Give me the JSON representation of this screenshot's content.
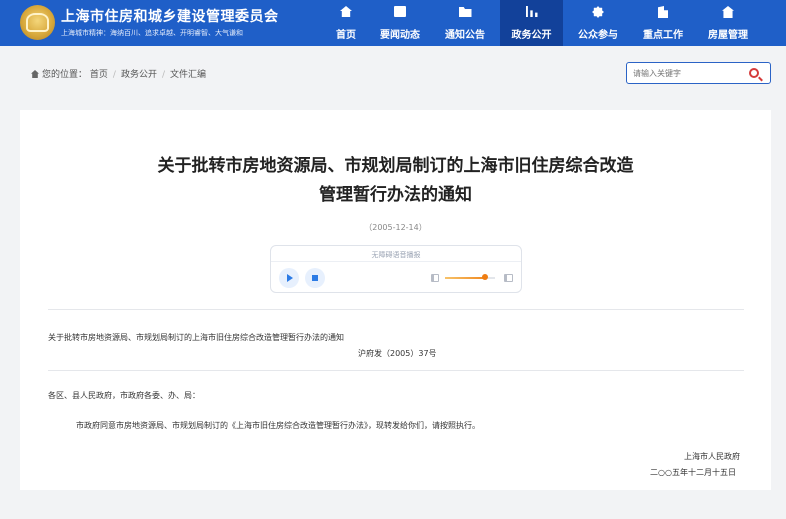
{
  "header": {
    "site_title": "上海市住房和城乡建设管理委员会",
    "slogan": "上海城市精神：海纳百川、追求卓越、开明睿智、大气谦和",
    "nav": [
      {
        "label": "首页",
        "icon": "home-icon"
      },
      {
        "label": "要闻动态",
        "icon": "news-icon"
      },
      {
        "label": "通知公告",
        "icon": "folder-icon"
      },
      {
        "label": "政务公开",
        "icon": "chart-icon",
        "active": true
      },
      {
        "label": "公众参与",
        "icon": "gear-icon"
      },
      {
        "label": "重点工作",
        "icon": "building-icon"
      },
      {
        "label": "房屋管理",
        "icon": "house-icon"
      }
    ]
  },
  "breadcrumb": {
    "prefix": "您的位置：",
    "items": [
      "首页",
      "政务公开",
      "文件汇编"
    ]
  },
  "search": {
    "placeholder": "请输入关键字"
  },
  "article": {
    "title_line1": "关于批转市房地资源局、市规划局制订的上海市旧住房综合改造",
    "title_line2": "管理暂行办法的通知",
    "date": "（2005-12-14）",
    "player": {
      "title": "无障碍语音播报",
      "volume_percent": 80
    },
    "ref_title": "关于批转市房地资源局、市规划局制订的上海市旧住房综合改造管理暂行办法的通知",
    "doc_number": "沪府发（2005）37号",
    "salutation": "各区、县人民政府，市政府各委、办、局：",
    "paragraph": "市政府同意市房地资源局、市规划局制订的《上海市旧住房综合改造管理暂行办法》，现转发给你们，请按照执行。",
    "signer": "上海市人民政府",
    "sign_date": "二○○五年十二月十五日"
  }
}
